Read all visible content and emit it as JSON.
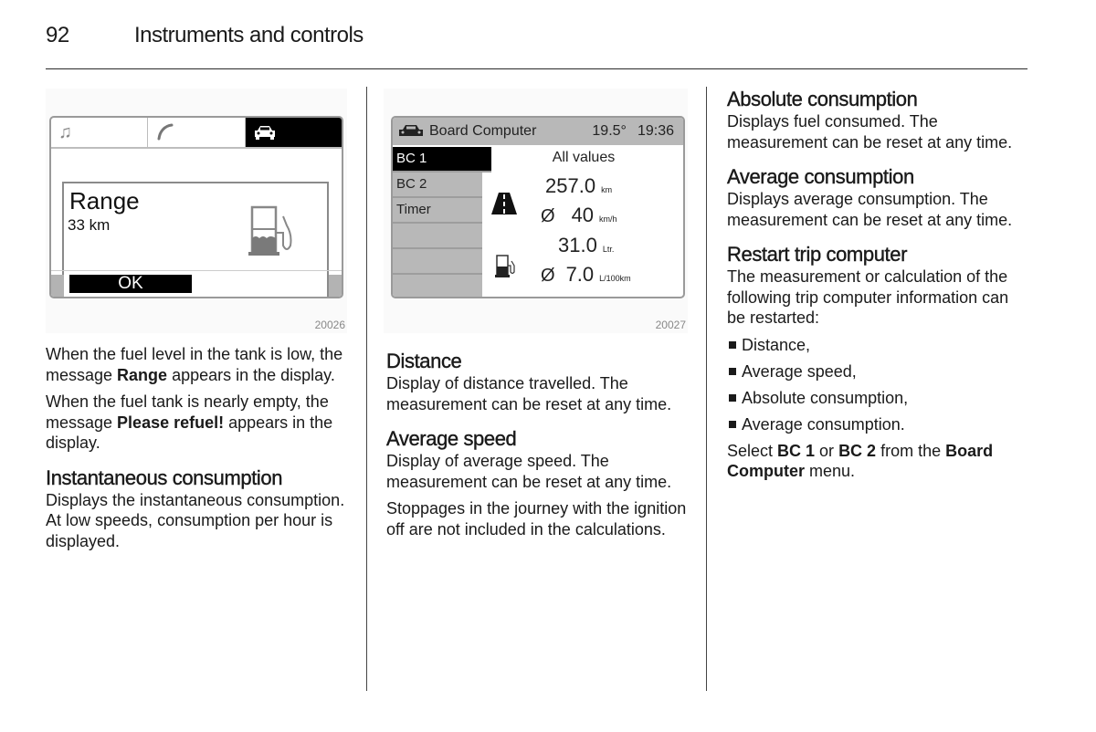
{
  "header": {
    "page_number": "92",
    "chapter_title": "Instruments and controls"
  },
  "figure_range": {
    "tabs": [
      {
        "icon": "music-note-icon",
        "glyph": "♫",
        "active": false
      },
      {
        "icon": "phone-icon",
        "glyph": "✆",
        "active": false
      },
      {
        "icon": "car-icon",
        "glyph": "🚘",
        "active": true
      }
    ],
    "title": "Range",
    "value": "33 km",
    "pump_icon": "fuel-pump-icon",
    "ok_label": "OK",
    "figure_id": "20026"
  },
  "figure_board_computer": {
    "header_icon": "car-icon",
    "header_title": "Board Computer",
    "temperature": "19.5°",
    "time": "19:36",
    "menu": [
      {
        "label": "BC 1",
        "active": true
      },
      {
        "label": "BC 2",
        "active": false
      },
      {
        "label": "Timer",
        "active": false
      },
      {
        "label": "",
        "active": false
      },
      {
        "label": "",
        "active": false
      },
      {
        "label": "",
        "active": false
      }
    ],
    "subtitle": "All values",
    "rows": {
      "distance": {
        "value": "257.0",
        "unit": "km"
      },
      "avg_speed": {
        "prefix": "Ø",
        "value": "40",
        "unit": "km/h"
      },
      "fuel_used": {
        "value": "31.0",
        "unit": "Ltr."
      },
      "avg_consumption": {
        "prefix": "Ø",
        "value": "7.0",
        "unit": "L/100km"
      }
    },
    "road_icon": "road-icon",
    "pump_icon": "fuel-pump-icon",
    "figure_id": "20027"
  },
  "column1": {
    "p1_a": "When the fuel level in the tank is low, the message ",
    "p1_bold": "Range",
    "p1_b": " appears in the display.",
    "p2_a": "When the fuel tank is nearly empty, the message ",
    "p2_bold": "Please refuel!",
    "p2_b": " appears in the display.",
    "h_instant": "Instantaneous consumption",
    "p_instant": "Displays the instantaneous consumption. At low speeds, consumption per hour is displayed."
  },
  "column2": {
    "h_distance": "Distance",
    "p_distance": "Display of distance travelled. The measurement can be reset at any time.",
    "h_avg_speed": "Average speed",
    "p_avg_speed": "Display of average speed. The measurement can be reset at any time.",
    "p_stoppages": "Stoppages in the journey with the ignition off are not included in the calculations."
  },
  "column3": {
    "h_absolute": "Absolute consumption",
    "p_absolute": "Displays fuel consumed. The measurement can be reset at any time.",
    "h_avg_cons": "Average consumption",
    "p_avg_cons": "Displays average consumption. The measurement can be reset at any time.",
    "h_restart": "Restart trip computer",
    "p_restart": "The measurement or calculation of the following trip computer information can be restarted:",
    "bullets": [
      "Distance,",
      "Average speed,",
      "Absolute consumption,",
      "Average consumption."
    ],
    "select_a": "Select ",
    "select_bc1": "BC 1",
    "select_or": " or ",
    "select_bc2": "BC 2",
    "select_from": " from the ",
    "select_board": "Board Computer",
    "select_menu": " menu."
  }
}
